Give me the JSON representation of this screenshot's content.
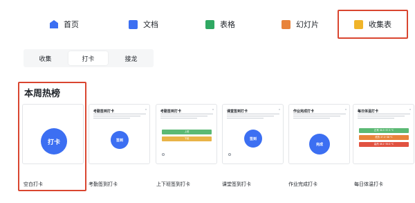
{
  "nav": {
    "items": [
      {
        "label": "首页",
        "icon": "home-icon"
      },
      {
        "label": "文档",
        "icon": "doc-icon"
      },
      {
        "label": "表格",
        "icon": "sheet-icon"
      },
      {
        "label": "幻灯片",
        "icon": "slides-icon"
      },
      {
        "label": "收集表",
        "icon": "form-icon",
        "active": true
      }
    ]
  },
  "tabs": [
    {
      "label": "收集"
    },
    {
      "label": "打卡",
      "active": true
    },
    {
      "label": "接龙"
    }
  ],
  "section": {
    "title": "本周热榜"
  },
  "cards": [
    {
      "label": "空白打卡",
      "circle": "打卡"
    },
    {
      "label": "考勤签到打卡",
      "title": "考勤签到打卡",
      "circle": "签到"
    },
    {
      "label": "上下班签到打卡",
      "title": "考勤签到打卡",
      "bar1": "上班",
      "bar2": "下班"
    },
    {
      "label": "课堂签到打卡",
      "title": "课堂签到打卡",
      "circle": "签到"
    },
    {
      "label": "作业完成打卡",
      "title": "作业完成打卡",
      "circle": "完成"
    },
    {
      "label": "每日体温打卡",
      "title": "每日体温打卡",
      "bar1": "正常 36.3~37.3 ℃",
      "bar2": "低热 37.3~38 ℃",
      "bar3": "高热 38.1~39.3 ℃"
    }
  ],
  "colors": {
    "accent": "#3c6ff2",
    "highlight_border": "#d9452f",
    "green": "#5bb974",
    "amber": "#e9b448",
    "orange": "#e8833a",
    "red": "#e15241"
  }
}
